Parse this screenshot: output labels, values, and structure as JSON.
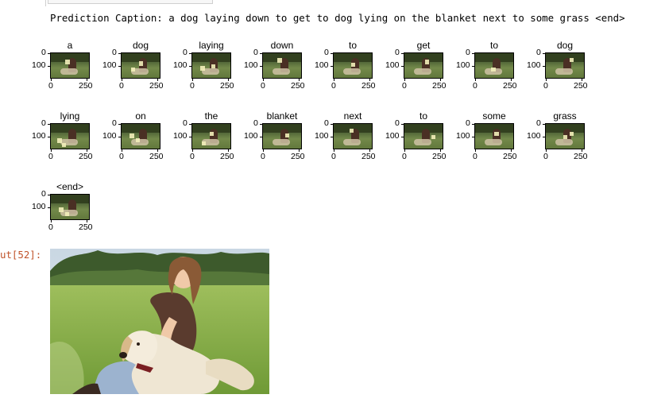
{
  "cell": {
    "prediction_caption": "Prediction Caption: a dog laying down to get to dog lying on the blanket next to some grass <end>",
    "output_prompt": "ut[52]:"
  },
  "attention_plots": {
    "words": [
      "a",
      "dog",
      "laying",
      "down",
      "to",
      "get",
      "to",
      "dog",
      "lying",
      "on",
      "the",
      "blanket",
      "next",
      "to",
      "some",
      "grass",
      "<end>"
    ],
    "y_ticks": [
      "0",
      "100"
    ],
    "x_ticks": [
      "0",
      "250"
    ]
  },
  "colors": {
    "output_prompt": "#c0532a",
    "attention_highlight": "#f2eeb9"
  }
}
